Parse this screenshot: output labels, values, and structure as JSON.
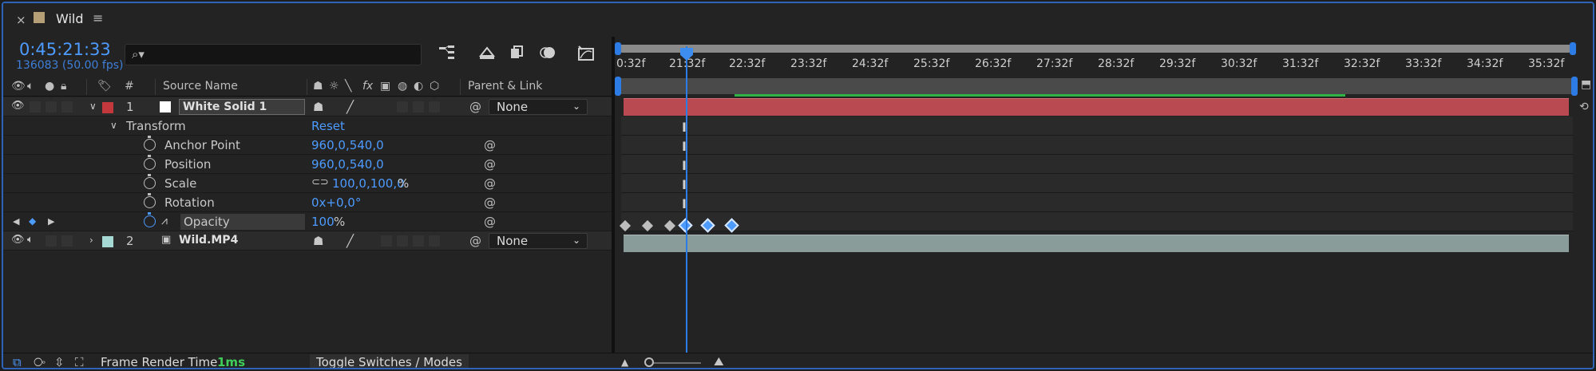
{
  "tab": {
    "close": "×",
    "title": "Wild",
    "menu": "≡",
    "swatch_color": "#b59f77"
  },
  "header": {
    "timecode": "0:45:21:33",
    "frame_info": "136083 (50.00 fps)",
    "search_placeholder": ""
  },
  "columns": {
    "hash": "#",
    "source_name": "Source Name",
    "parent_link": "Parent & Link",
    "fx": "fx"
  },
  "layers": [
    {
      "index": "1",
      "name": "White Solid 1",
      "label_color": "#c2383d",
      "parent": "None",
      "transform": {
        "label": "Transform",
        "reset": "Reset",
        "props": [
          {
            "name": "Anchor Point",
            "value": "960,0,540,0"
          },
          {
            "name": "Position",
            "value": "960,0,540,0"
          },
          {
            "name": "Scale",
            "value": "100,0,100,0",
            "unit": "%"
          },
          {
            "name": "Rotation",
            "value": "0x+0,0°"
          },
          {
            "name": "Opacity",
            "value": "100",
            "unit": "%"
          }
        ]
      }
    },
    {
      "index": "2",
      "name": "Wild.MP4",
      "label_color": "#a6d9d4",
      "parent": "None"
    }
  ],
  "ruler": {
    "ticks": [
      "0:32f",
      "21:32f",
      "22:32f",
      "23:32f",
      "24:32f",
      "25:32f",
      "26:32f",
      "27:32f",
      "28:32f",
      "29:32f",
      "30:32f",
      "31:32f",
      "32:32f",
      "33:32f",
      "34:32f",
      "35:32f"
    ]
  },
  "footer": {
    "frame_render_label": "Frame Render Time",
    "frame_render_value": "1ms",
    "toggle_label": "Toggle Switches / Modes"
  },
  "colors": {
    "accent": "#4d9bff",
    "layer1_bar": "#b94a52",
    "layer2_bar": "#8a9c99",
    "work_green": "#2fb344"
  }
}
